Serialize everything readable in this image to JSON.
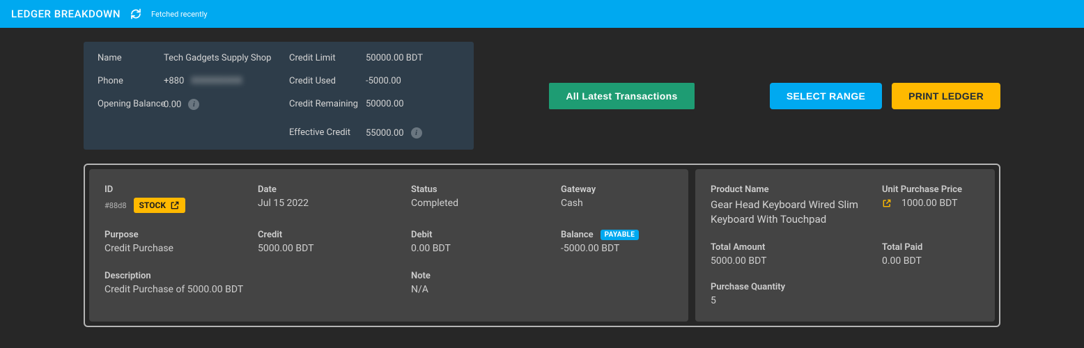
{
  "header": {
    "title": "LEDGER BREAKDOWN",
    "fetched": "Fetched recently"
  },
  "info": {
    "name_label": "Name",
    "name_value": "Tech Gadgets Supply Shop",
    "phone_label": "Phone",
    "phone_prefix": "+880",
    "phone_blur": "XXXXXXXXX",
    "opening_label": "Opening Balance",
    "opening_value": "0.00",
    "credit_limit_label": "Credit Limit",
    "credit_limit_value": "50000.00 BDT",
    "credit_used_label": "Credit Used",
    "credit_used_value": "-5000.00",
    "credit_remaining_label": "Credit Remaining",
    "credit_remaining_value": "50000.00",
    "effective_label": "Effective Credit",
    "effective_value": "55000.00"
  },
  "actions": {
    "latest": "All Latest Transactions",
    "range": "SELECT RANGE",
    "print": "PRINT LEDGER"
  },
  "tx": {
    "id_label": "ID",
    "id_value": "#88d8",
    "stock_badge": "STOCK",
    "date_label": "Date",
    "date_value": "Jul 15 2022",
    "status_label": "Status",
    "status_value": "Completed",
    "gateway_label": "Gateway",
    "gateway_value": "Cash",
    "purpose_label": "Purpose",
    "purpose_value": "Credit Purchase",
    "credit_label": "Credit",
    "credit_value": "5000.00 BDT",
    "debit_label": "Debit",
    "debit_value": "0.00 BDT",
    "balance_label": "Balance",
    "balance_badge": "PAYABLE",
    "balance_value": "-5000.00 BDT",
    "description_label": "Description",
    "description_value": "Credit Purchase of 5000.00 BDT",
    "note_label": "Note",
    "note_value": "N/A"
  },
  "product": {
    "name_label": "Product Name",
    "name_value": "Gear Head Keyboard Wired Slim Keyboard With Touchpad",
    "unit_label": "Unit Purchase Price",
    "unit_value": "1000.00 BDT",
    "total_amount_label": "Total Amount",
    "total_amount_value": "5000.00 BDT",
    "total_paid_label": "Total Paid",
    "total_paid_value": "0.00 BDT",
    "qty_label": "Purchase Quantity",
    "qty_value": "5"
  }
}
